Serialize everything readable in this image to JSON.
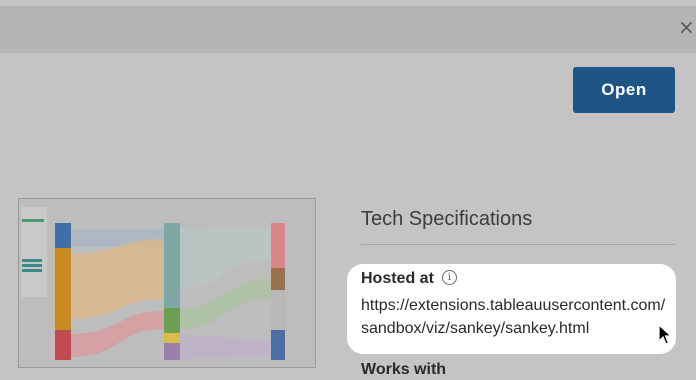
{
  "dialog": {
    "close_glyph": "×",
    "open_label": "Open"
  },
  "spec": {
    "title": "Tech Specifications",
    "hosted_label": "Hosted at",
    "info_glyph": "i",
    "hosted_url": "https://extensions.tableauusercontent.com/sandbox/viz/sankey/sankey.html",
    "works_with_label": "Works with"
  },
  "colors": {
    "accent": "#1f5486",
    "overlay": "#c4c4c4",
    "card": "#ffffff"
  },
  "icons": [
    "close-icon",
    "info-icon",
    "mouse-pointer-icon"
  ]
}
